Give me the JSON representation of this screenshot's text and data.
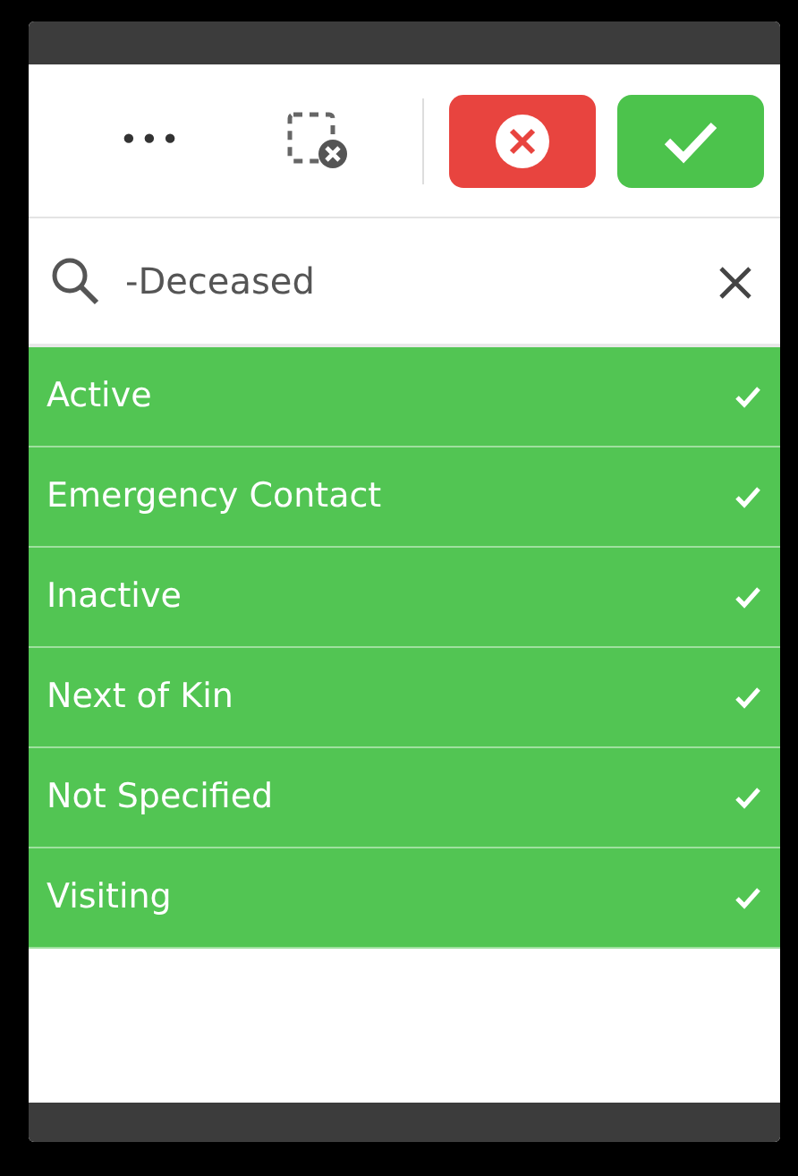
{
  "toolbar": {
    "more_label": "•••"
  },
  "search": {
    "value": "-Deceased"
  },
  "items": [
    {
      "label": "Active",
      "selected": true
    },
    {
      "label": "Emergency Contact",
      "selected": true
    },
    {
      "label": "Inactive",
      "selected": true
    },
    {
      "label": "Next of Kin",
      "selected": true
    },
    {
      "label": "Not Specified",
      "selected": true
    },
    {
      "label": "Visiting",
      "selected": true
    }
  ]
}
